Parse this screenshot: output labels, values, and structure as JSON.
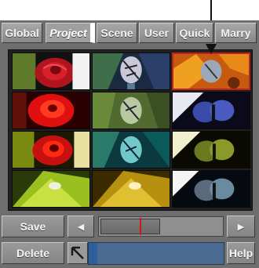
{
  "tabs": [
    {
      "label": "Global",
      "active": false
    },
    {
      "label": "Project",
      "active": true
    },
    {
      "label": "Scene",
      "active": false
    },
    {
      "label": "User",
      "active": false
    },
    {
      "label": "Quick",
      "active": false
    },
    {
      "label": "Marry",
      "active": false
    }
  ],
  "thumbnails": [
    {
      "subject": "rose",
      "variant": "original"
    },
    {
      "subject": "butterfly",
      "variant": "original"
    },
    {
      "subject": "butterfly-flower",
      "variant": "original",
      "selected": true
    },
    {
      "subject": "rose",
      "variant": "red-tint"
    },
    {
      "subject": "butterfly",
      "variant": "green-tint"
    },
    {
      "subject": "butterfly",
      "variant": "blue-night"
    },
    {
      "subject": "rose",
      "variant": "saturated"
    },
    {
      "subject": "butterfly",
      "variant": "teal-tint"
    },
    {
      "subject": "butterfly",
      "variant": "green-night"
    },
    {
      "subject": "leaf",
      "variant": "yellow-green"
    },
    {
      "subject": "leaf",
      "variant": "gold"
    },
    {
      "subject": "butterfly",
      "variant": "grey-night"
    }
  ],
  "buttons": {
    "save": "Save",
    "delete": "Delete",
    "help": "Help",
    "prev_icon": "triangle-left-icon",
    "next_icon": "triangle-right-icon",
    "home_icon": "arrow-up-left-icon"
  },
  "scrubber": {
    "position": 0.31
  },
  "colors": {
    "panel": "#6e6e6e",
    "selection": "#c02020",
    "strip": "#4a6a92",
    "marker": "#d01818"
  }
}
